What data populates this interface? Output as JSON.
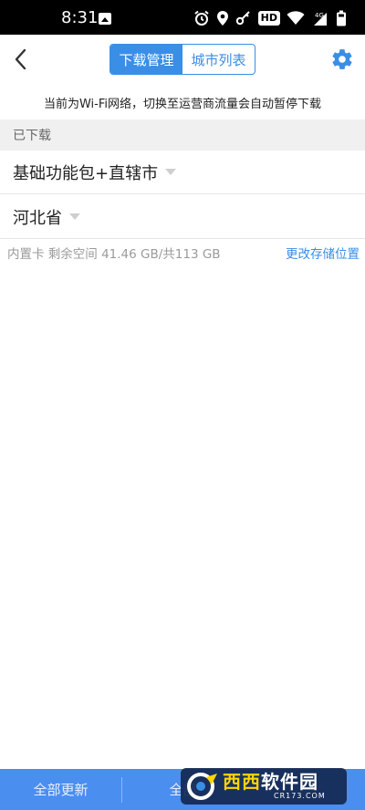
{
  "status_bar": {
    "time": "8:31",
    "hd_badge": "HD",
    "network": "4G",
    "icons": [
      "gallery-icon",
      "alarm-icon",
      "location-icon",
      "key-icon",
      "wifi-icon",
      "signal-icon",
      "battery-icon"
    ]
  },
  "header": {
    "tabs": [
      {
        "label": "下载管理",
        "active": true
      },
      {
        "label": "城市列表",
        "active": false
      }
    ],
    "accent": "#3a8ee6"
  },
  "notice": "当前为Wi-Fi网络，切换至运营商流量会自动暂停下载",
  "section": {
    "title": "已下载"
  },
  "downloaded": [
    {
      "label": "基础功能包+直辖市"
    },
    {
      "label": "河北省"
    }
  ],
  "storage": {
    "info": "内置卡 剩余空间 41.46 GB/共113 GB",
    "change_link": "更改存储位置"
  },
  "bottom_bar": {
    "update_all": "全部更新",
    "second_button": "全部",
    "color": "#4a8ef0"
  },
  "watermark": {
    "text_a": "西西",
    "text_b": "软件园",
    "sub": "CR173.COM"
  }
}
